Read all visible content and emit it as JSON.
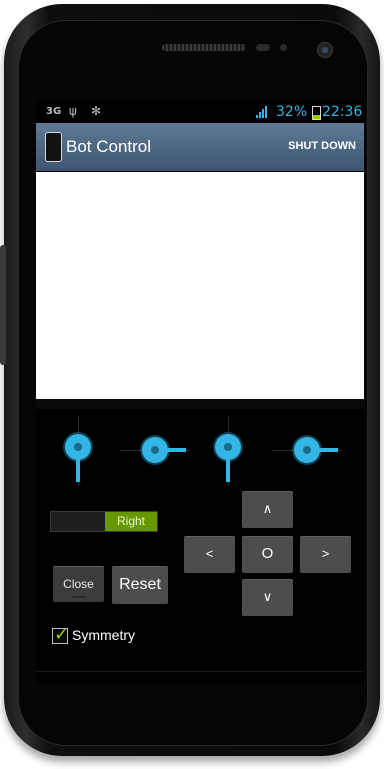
{
  "status_bar": {
    "network": "3G",
    "usb_icon": "usb-icon",
    "debug_icon": "android-debug-icon",
    "battery_percent": "32%",
    "time": "22:36",
    "accent_color": "#33b5e5"
  },
  "action_bar": {
    "title": "Bot Control",
    "action": "SHUT DOWN",
    "app_icon": "phone-app-icon"
  },
  "sliders": [
    {
      "orientation": "vertical",
      "position": "down"
    },
    {
      "orientation": "horizontal",
      "position": "right"
    },
    {
      "orientation": "vertical",
      "position": "down"
    },
    {
      "orientation": "horizontal",
      "position": "right"
    }
  ],
  "controls": {
    "toggle_right_label": "Right",
    "close_label": "Close",
    "reset_label": "Reset",
    "symmetry_label": "Symmetry",
    "symmetry_checked": true
  },
  "dpad": {
    "up": "∧",
    "left": "<",
    "center": "O",
    "right": ">",
    "down": "∨"
  },
  "colors": {
    "toggle_on": "#669900",
    "checkbox_mark": "#99cc00",
    "button_bg": "#4d4d4d"
  }
}
